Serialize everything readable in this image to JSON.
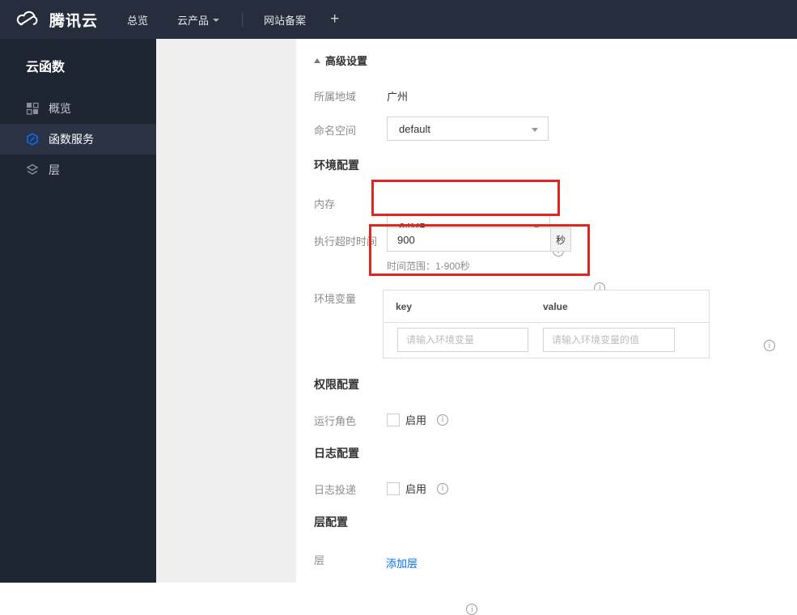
{
  "topnav": {
    "brand": "腾讯云",
    "overview": "总览",
    "products": "云产品",
    "beian": "网站备案",
    "plus": "+"
  },
  "sidebar": {
    "title": "云函数",
    "items": [
      {
        "label": "概览",
        "icon": "grid-icon",
        "active": false
      },
      {
        "label": "函数服务",
        "icon": "function-hexagon-icon",
        "active": true
      },
      {
        "label": "层",
        "icon": "layers-icon",
        "active": false
      }
    ]
  },
  "form": {
    "advanced_settings": "高级设置",
    "region_label": "所属地域",
    "region_value": "广州",
    "namespace_label": "命名空间",
    "namespace_value": "default",
    "env_config_title": "环境配置",
    "memory_label": "内存",
    "memory_value": "64MB",
    "timeout_label": "执行超时时间",
    "timeout_value": "900",
    "timeout_unit": "秒",
    "timeout_hint": "时间范围：1-900秒",
    "env_vars_label": "环境变量",
    "env_key_header": "key",
    "env_value_header": "value",
    "env_key_placeholder": "请输入环境变量",
    "env_value_placeholder": "请输入环境变量的值",
    "perm_config_title": "权限配置",
    "run_role_label": "运行角色",
    "run_role_enable_label": "启用",
    "log_config_title": "日志配置",
    "log_delivery_label": "日志投递",
    "log_delivery_enable_label": "启用",
    "layer_config_title": "层配置",
    "layer_label": "层",
    "add_layer_label": "添加层"
  },
  "colors": {
    "accent_blue": "#006eff",
    "annotation_red": "#e12622",
    "nav_bg": "#262e3d",
    "sidebar_bg": "#1e2533"
  }
}
